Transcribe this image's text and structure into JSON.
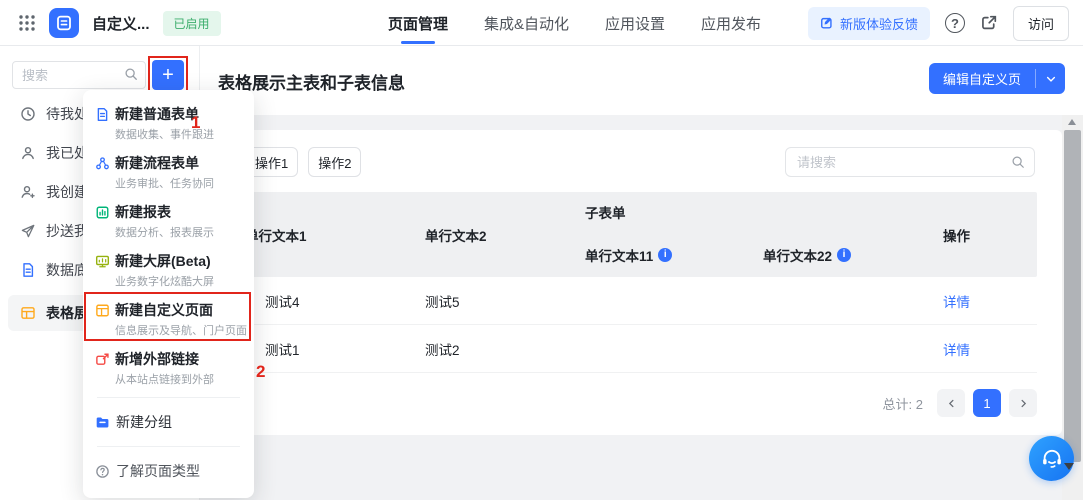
{
  "colors": {
    "accent": "#3370ff",
    "annotation_red": "#e1251b",
    "badge_green": "#3dae6d",
    "link_blue": "#3370ff"
  },
  "navbar": {
    "app_title": "自定义...",
    "status_badge": "已启用",
    "tabs": [
      {
        "label": "页面管理"
      },
      {
        "label": "集成&自动化"
      },
      {
        "label": "应用设置"
      },
      {
        "label": "应用发布"
      }
    ],
    "active_tab": "页面管理",
    "feedback_button": "新版体验反馈",
    "help_glyph": "?",
    "visit_button": "访问"
  },
  "sidebar": {
    "search_placeholder": "搜索",
    "plus_button": "+",
    "items": [
      {
        "label": "待我处",
        "icon": "clock-icon"
      },
      {
        "label": "我已处",
        "icon": "user-icon"
      },
      {
        "label": "我创建",
        "icon": "user-plus-icon"
      },
      {
        "label": "抄送我",
        "icon": "send-icon"
      },
      {
        "label": "数据底",
        "icon": "document-icon"
      },
      {
        "label": "表格展",
        "icon": "table-icon",
        "selected": true
      }
    ]
  },
  "annotations": {
    "step1": "1",
    "step2": "2"
  },
  "create_menu": {
    "items": [
      {
        "title": "新建普通表单",
        "subtitle": "数据收集、事件跟进",
        "icon": "form-icon"
      },
      {
        "title": "新建流程表单",
        "subtitle": "业务审批、任务协同",
        "icon": "flow-icon"
      },
      {
        "title": "新建报表",
        "subtitle": "数据分析、报表展示",
        "icon": "report-icon"
      },
      {
        "title": "新建大屏(Beta)",
        "subtitle": "业务数字化炫酷大屏",
        "icon": "bigscreen-icon"
      },
      {
        "title": "新建自定义页面",
        "subtitle": "信息展示及导航、门户页面",
        "icon": "custom-page-icon",
        "highlighted": true
      },
      {
        "title": "新增外部链接",
        "subtitle": "从本站点链接到外部",
        "icon": "external-link-icon"
      }
    ],
    "group_item": "新建分组",
    "help_item": "了解页面类型"
  },
  "main": {
    "page_title": "表格展示主表和子表信息",
    "edit_button": "编辑自定义页",
    "action_button_1": "操作1",
    "action_button_2": "操作2",
    "search_placeholder": "请搜索",
    "table": {
      "col1": "单行文本1",
      "col2": "单行文本2",
      "group": "子表单",
      "sub1": "单行文本11",
      "sub2": "单行文本22",
      "op": "操作",
      "info_glyph": "i",
      "rows": [
        {
          "c1": "测试4",
          "c2": "测试5",
          "sub1": "",
          "sub2": "",
          "action": "详情"
        },
        {
          "c1": "测试1",
          "c2": "测试2",
          "sub1": "",
          "sub2": "",
          "action": "详情"
        }
      ]
    },
    "pagination": {
      "total": "总计: 2",
      "page": "1"
    }
  }
}
